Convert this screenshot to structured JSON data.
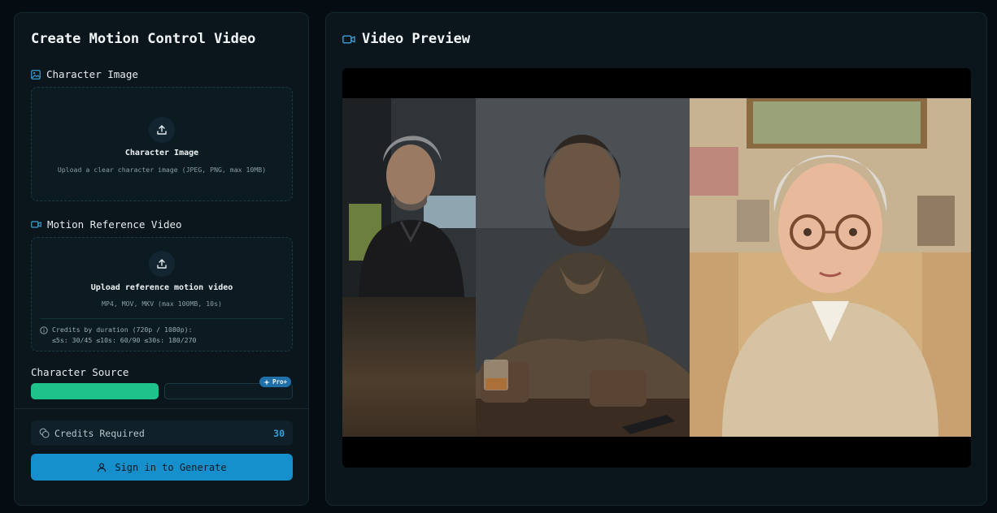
{
  "left_panel": {
    "title": "Create Motion Control Video",
    "character_image": {
      "label": "Character Image",
      "upload_title": "Character Image",
      "upload_hint": "Upload a clear character image (JPEG, PNG, max 10MB)"
    },
    "motion_reference": {
      "label": "Motion Reference Video",
      "upload_title": "Upload reference motion video",
      "upload_hint": "MP4, MOV, MKV (max 100MB, 10s)",
      "credits_note_line1": "Credits by duration (720p / 1080p):",
      "credits_note_line2": "≤5s: 30/45  ≤10s: 60/90  ≤30s: 180/270"
    },
    "character_source": {
      "label": "Character Source",
      "pro_badge": "Pro+"
    },
    "credits": {
      "label": "Credits Required",
      "value": "30"
    },
    "signin_button": "Sign in to Generate"
  },
  "right_panel": {
    "title": "Video Preview"
  },
  "colors": {
    "background": "#050d12",
    "panel": "#0a161c",
    "accent_green": "#1ec38c",
    "accent_blue": "#1590cc",
    "credits_value": "#3aa0d8",
    "pro_badge": "#1f6fa8"
  },
  "icons": {
    "character_image": "image-icon",
    "motion_reference": "video-icon",
    "upload": "upload-icon",
    "info": "info-icon",
    "credits": "coins-icon",
    "signin": "user-icon",
    "preview": "video-icon",
    "pro": "sparkle-icon"
  }
}
